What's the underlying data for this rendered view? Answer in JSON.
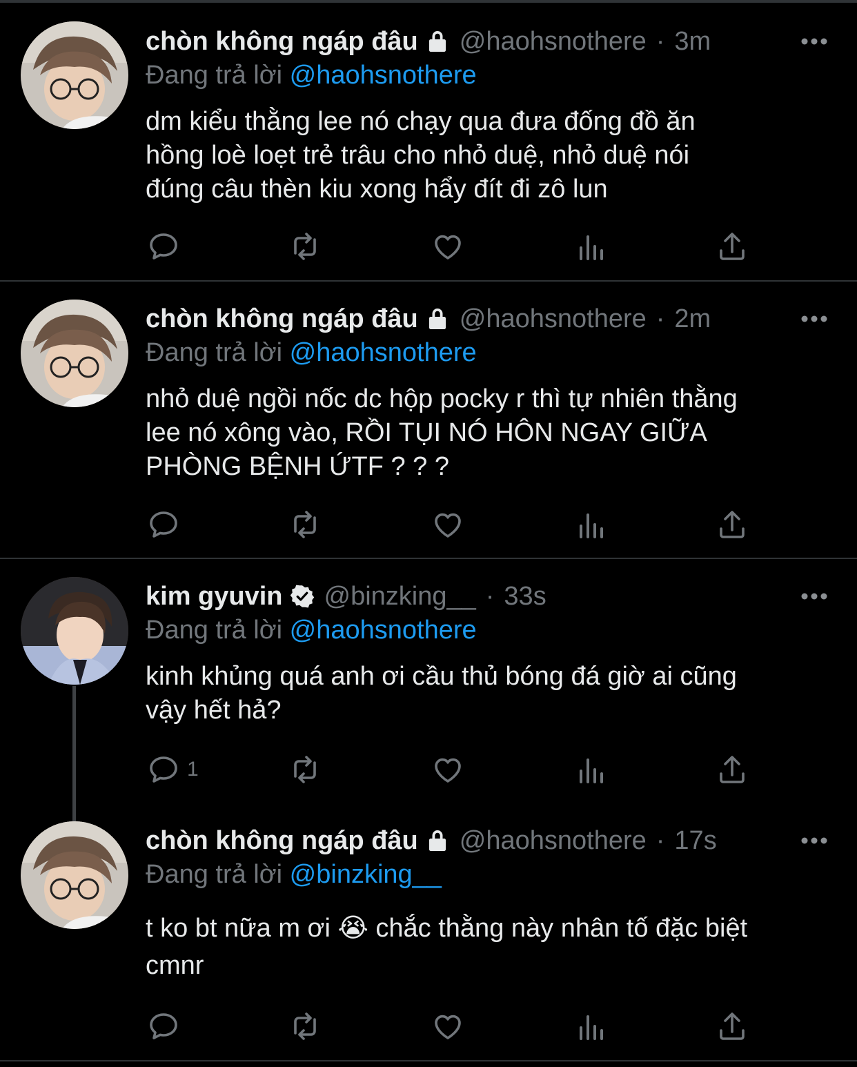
{
  "tweets": [
    {
      "name": "chòn không ngáp đâu",
      "badge": "lock-icon",
      "handle": "@haohsnothere",
      "separator": "·",
      "time": "3m",
      "replying_prefix": "Đang trả lời",
      "replying_to": "@haohsnothere",
      "body": [
        "dm kiểu thằng lee nó chạy qua đưa đống đồ ăn",
        "hồng loè loẹt trẻ trâu cho nhỏ duệ, nhỏ duệ nói",
        "đúng câu thèn kiu xong hẩy đít đi zô lun"
      ],
      "reply_count": ""
    },
    {
      "name": "chòn không ngáp đâu",
      "badge": "lock-icon",
      "handle": "@haohsnothere",
      "separator": "·",
      "time": "2m",
      "replying_prefix": "Đang trả lời",
      "replying_to": "@haohsnothere",
      "body": [
        "nhỏ duệ ngồi nốc dc hộp pocky r thì tự nhiên thằng",
        "lee nó xông vào, RỒI TỤI NÓ HÔN NGAY GIỮA",
        "PHÒNG BỆNH ỨTF ? ? ?"
      ],
      "reply_count": ""
    },
    {
      "name": "kim gyuvin",
      "badge": "verified-icon",
      "handle": "@binzking__",
      "separator": "·",
      "time": "33s",
      "replying_prefix": "Đang trả lời",
      "replying_to": "@haohsnothere",
      "body": [
        "kinh khủng quá anh ơi cầu thủ bóng đá giờ ai cũng",
        "vậy hết hả?"
      ],
      "reply_count": "1"
    },
    {
      "name": "chòn không ngáp đâu",
      "badge": "lock-icon",
      "handle": "@haohsnothere",
      "separator": "·",
      "time": "17s",
      "replying_prefix": "Đang trả lời",
      "replying_to": "@binzking__",
      "body": [
        "t ko bt nữa m ơi 😭 chắc thằng này nhân tố đặc biệt",
        "cmnr"
      ],
      "reply_count": ""
    }
  ],
  "icons": {
    "reply": "reply-icon",
    "retweet": "retweet-icon",
    "like": "heart-icon",
    "analytics": "analytics-icon",
    "share": "share-icon",
    "more": "more-icon"
  },
  "colors": {
    "background": "#000000",
    "text": "#e7e9ea",
    "muted": "#71767b",
    "link": "#1d9bf0",
    "divider": "#2f3336"
  }
}
